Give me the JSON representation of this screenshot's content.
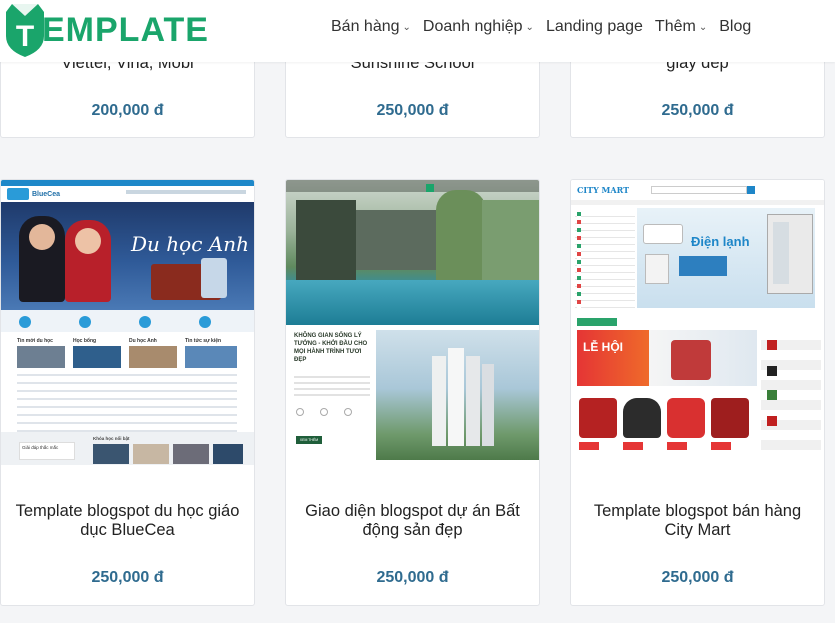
{
  "header": {
    "logo_text": "EMPLATE",
    "logo_letter": "T",
    "nav": [
      {
        "label": "Bán hàng",
        "has_dropdown": true
      },
      {
        "label": "Doanh nghiệp",
        "has_dropdown": true
      },
      {
        "label": "Landing page",
        "has_dropdown": false
      },
      {
        "label": "Thêm",
        "has_dropdown": true
      },
      {
        "label": "Blog",
        "has_dropdown": false
      }
    ]
  },
  "top_row": [
    {
      "title_partial": "Viettel, Vina, Mobi",
      "price": "200,000 đ"
    },
    {
      "title_partial": "Sunshine School",
      "price": "250,000 đ"
    },
    {
      "title_partial": "giày dép",
      "price": "250,000 đ"
    }
  ],
  "products": [
    {
      "title": "Template blogspot du học giáo dục BlueCea",
      "price": "250,000 đ",
      "thumb": {
        "brand": "BlueCea",
        "banner_text": "Du học Anh",
        "sections": [
          "Tin mới du học",
          "Học bổng",
          "Du học Anh",
          "Tin tức sự kiện"
        ],
        "footer_box": "Giải đáp thắc mắc",
        "footer_label": "Khóa học nổi bật"
      }
    },
    {
      "title": "Giao diện blogspot dự án Bất động sản đẹp",
      "price": "250,000 đ",
      "thumb": {
        "heading": "KHÔNG GIAN SỐNG LÝ TƯỞNG - KHỞI ĐẦU CHO MỌI HÀNH TRÌNH TƯƠI ĐẸP",
        "button": "XEM THÊM"
      }
    },
    {
      "title": "Template blogspot bán hàng City Mart",
      "price": "250,000 đ",
      "thumb": {
        "brand": "CITY MART",
        "banner_text": "Điện lạnh",
        "sale_text": "LỄ HỘI"
      }
    }
  ],
  "colors": {
    "accent": "#1aa56b",
    "price": "#2f6b8f",
    "background": "#f4f5f7"
  }
}
